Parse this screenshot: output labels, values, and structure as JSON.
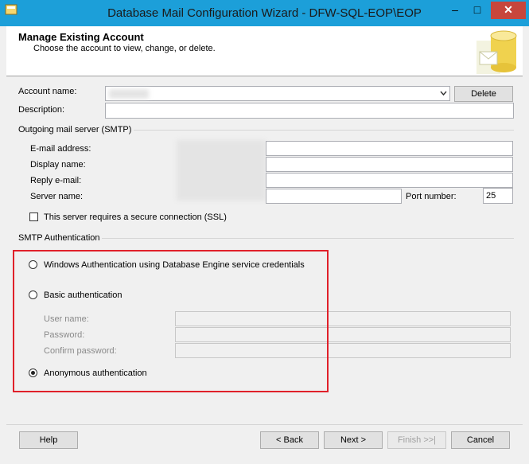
{
  "window": {
    "title": "Database Mail Configuration Wizard - DFW-SQL-EOP\\EOP",
    "minimize_glyph": "–",
    "maximize_glyph": "□",
    "close_glyph": "✕"
  },
  "header": {
    "title": "Manage Existing Account",
    "subtitle": "Choose the account to view, change, or delete."
  },
  "account": {
    "name_label": "Account name:",
    "description_label": "Description:",
    "delete_button": "Delete"
  },
  "smtp": {
    "group_label": "Outgoing mail server (SMTP)",
    "email_label": "E-mail address:",
    "display_name_label": "Display name:",
    "reply_email_label": "Reply e-mail:",
    "server_name_label": "Server name:",
    "port_label": "Port number:",
    "port_value": "25",
    "ssl_label": "This server requires a secure connection (SSL)",
    "ssl_checked": false
  },
  "auth": {
    "group_label": "SMTP Authentication",
    "windows_label": "Windows Authentication using Database Engine service credentials",
    "basic_label": "Basic authentication",
    "user_name_label": "User name:",
    "password_label": "Password:",
    "confirm_password_label": "Confirm password:",
    "anonymous_label": "Anonymous authentication",
    "selected": "anonymous"
  },
  "footer": {
    "help": "Help",
    "back": "< Back",
    "next": "Next >",
    "finish": "Finish >>|",
    "cancel": "Cancel"
  },
  "colors": {
    "titlebar": "#1c9fd9",
    "close_button": "#c7463c",
    "highlight_box": "#e0202a"
  }
}
